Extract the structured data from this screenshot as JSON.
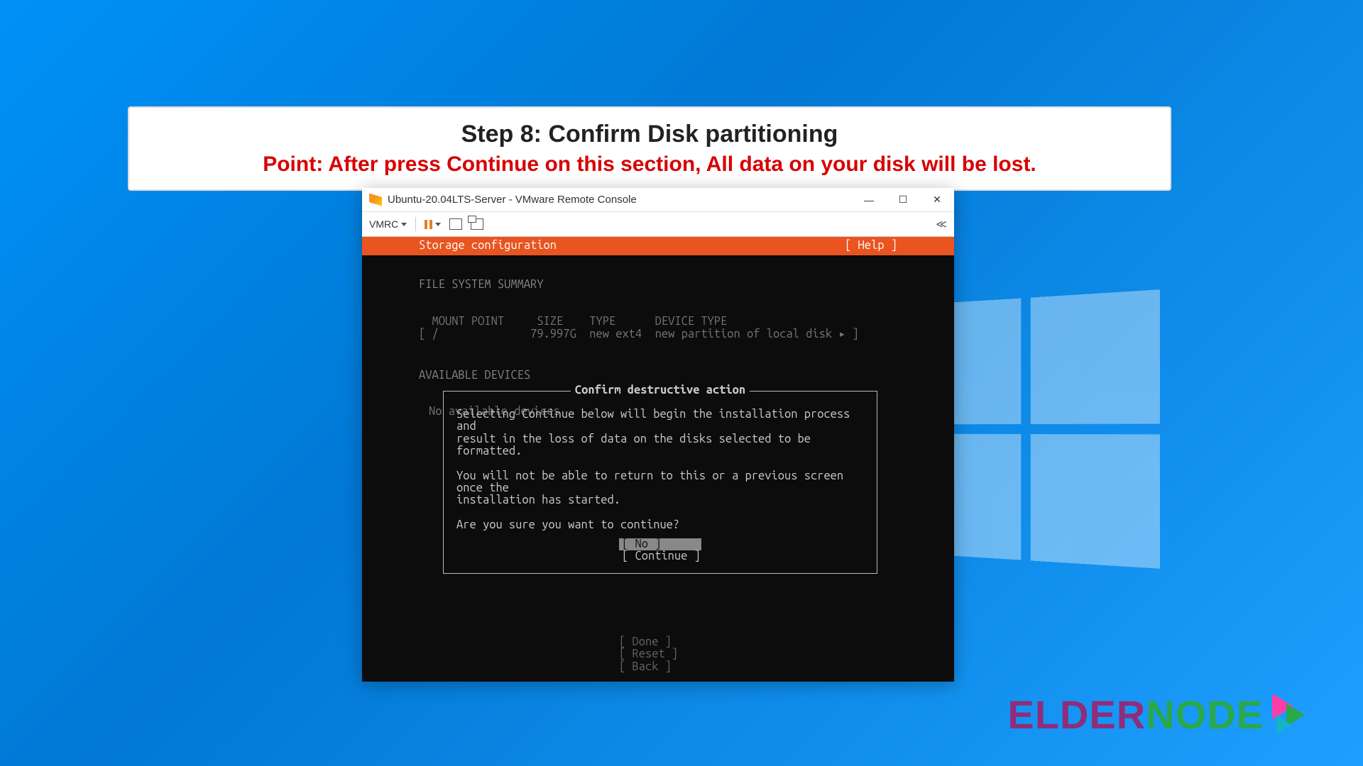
{
  "banner": {
    "title": "Step 8: Confirm Disk partitioning",
    "point": "Point: After press Continue on this section, All data on your disk will be lost."
  },
  "window": {
    "title": "Ubuntu-20.04LTS-Server - VMware Remote Console",
    "menu_label": "VMRC"
  },
  "installer": {
    "header_title": "Storage configuration",
    "help_label": "[ Help ]",
    "fs_summary_label": "FILE SYSTEM SUMMARY",
    "columns": "  MOUNT POINT     SIZE    TYPE      DEVICE TYPE",
    "fs_row": "[ /              79.997G  new ext4  new partition of local disk ▸ ]",
    "available_label": "AVAILABLE DEVICES",
    "no_devices": "No available devices",
    "dialog": {
      "title": "Confirm destructive action",
      "body": "Selecting Continue below will begin the installation process and\nresult in the loss of data on the disks selected to be formatted.\n\nYou will not be able to return to this or a previous screen once the\ninstallation has started.\n\nAre you sure you want to continue?",
      "no_label": "[ No         ]",
      "continue_label": "[ Continue   ]"
    },
    "bottom": {
      "done": "[ Done       ]",
      "reset": "[ Reset      ]",
      "back": "[ Back       ]"
    }
  },
  "brand": {
    "elder": "ELDER",
    "node": "NODE"
  }
}
